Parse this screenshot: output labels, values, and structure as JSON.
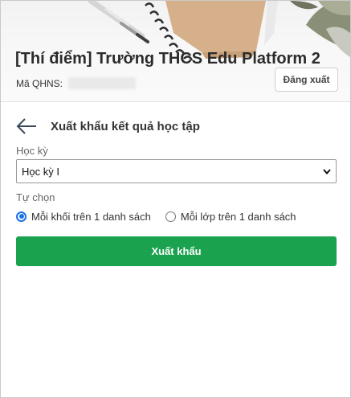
{
  "header": {
    "school_name": "[Thí điểm] Trường THCS Edu Platform 2",
    "qhns_label": "Mã QHNS:",
    "logout_label": "Đăng xuất"
  },
  "page": {
    "title": "Xuất khẩu kết quả học tập"
  },
  "form": {
    "semester_label": "Học kỳ",
    "semester_value": "Học kỳ I",
    "option_label": "Tự chọn",
    "options": [
      {
        "label": "Mỗi khối trên 1 danh sách",
        "checked": true
      },
      {
        "label": "Mỗi lớp trên 1 danh sách",
        "checked": false
      }
    ],
    "export_label": "Xuất khẩu"
  },
  "colors": {
    "accent_green": "#1aa24f",
    "radio_blue": "#1a73e8"
  }
}
